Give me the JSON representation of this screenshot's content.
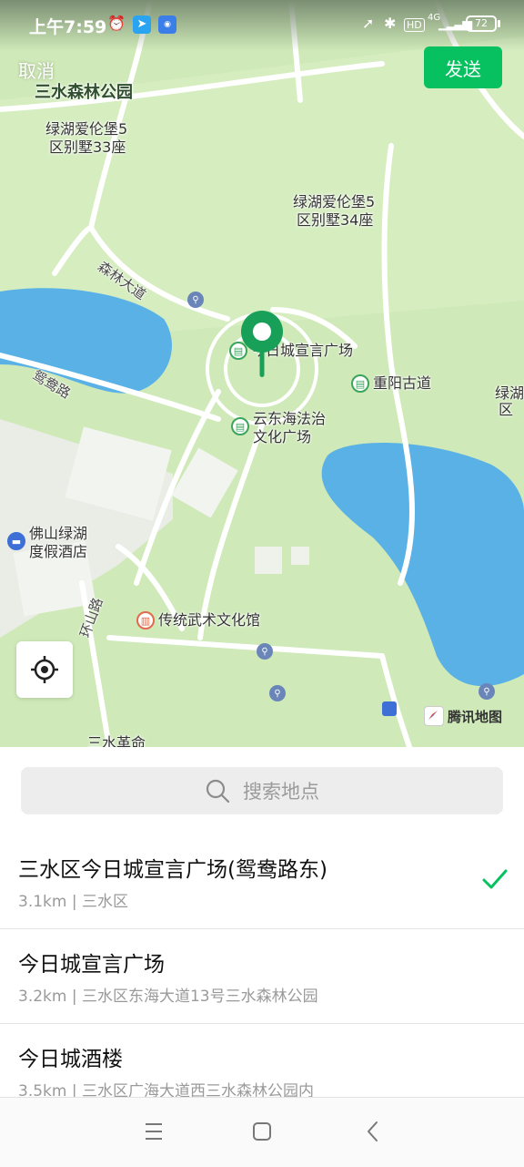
{
  "status_bar": {
    "time": "上午7:59",
    "battery": "72",
    "network": "4G"
  },
  "header": {
    "cancel_label": "取消",
    "send_label": "发送"
  },
  "map": {
    "labels": {
      "park": "三水森林公园",
      "villa33_l1": "绿湖爱伦堡5",
      "villa33_l2": "区别墅33座",
      "villa34_l1": "绿湖爱伦堡5",
      "villa34_l2": "区别墅34座",
      "road_senlin": "森林大道",
      "road_yuanyang": "鸳鸯路",
      "road_huanshan": "环山路",
      "poi_square": "今日城宣言广场",
      "poi_chongyang": "重阳古道",
      "poi_yundong_l1": "云东海法治",
      "poi_yundong_l2": "文化广场",
      "hotel_l1": "佛山绿湖",
      "hotel_l2": "度假酒店",
      "poi_wushu": "传统武术文化馆",
      "right_edge_l1": "绿湖",
      "right_edge_l2": "区",
      "bottom_cut": "三水革命"
    },
    "provider": "腾讯地图",
    "colors": {
      "land": "#cfe9b8",
      "water": "#5ab1e6",
      "pin": "#18a058"
    }
  },
  "search": {
    "placeholder": "搜索地点",
    "icon": "search-icon"
  },
  "results": [
    {
      "name": "三水区今日城宣言广场(鸳鸯路东)",
      "detail": "3.1km | 三水区",
      "selected": true
    },
    {
      "name": "今日城宣言广场",
      "detail": "3.2km | 三水区东海大道13号三水森林公园",
      "selected": false
    },
    {
      "name": "今日城酒楼",
      "detail": "3.5km | 三水区广海大道西三水森林公园内",
      "selected": false
    }
  ],
  "nav": {
    "menu_icon": "menu-icon",
    "home_icon": "home-icon",
    "back_icon": "back-icon"
  }
}
